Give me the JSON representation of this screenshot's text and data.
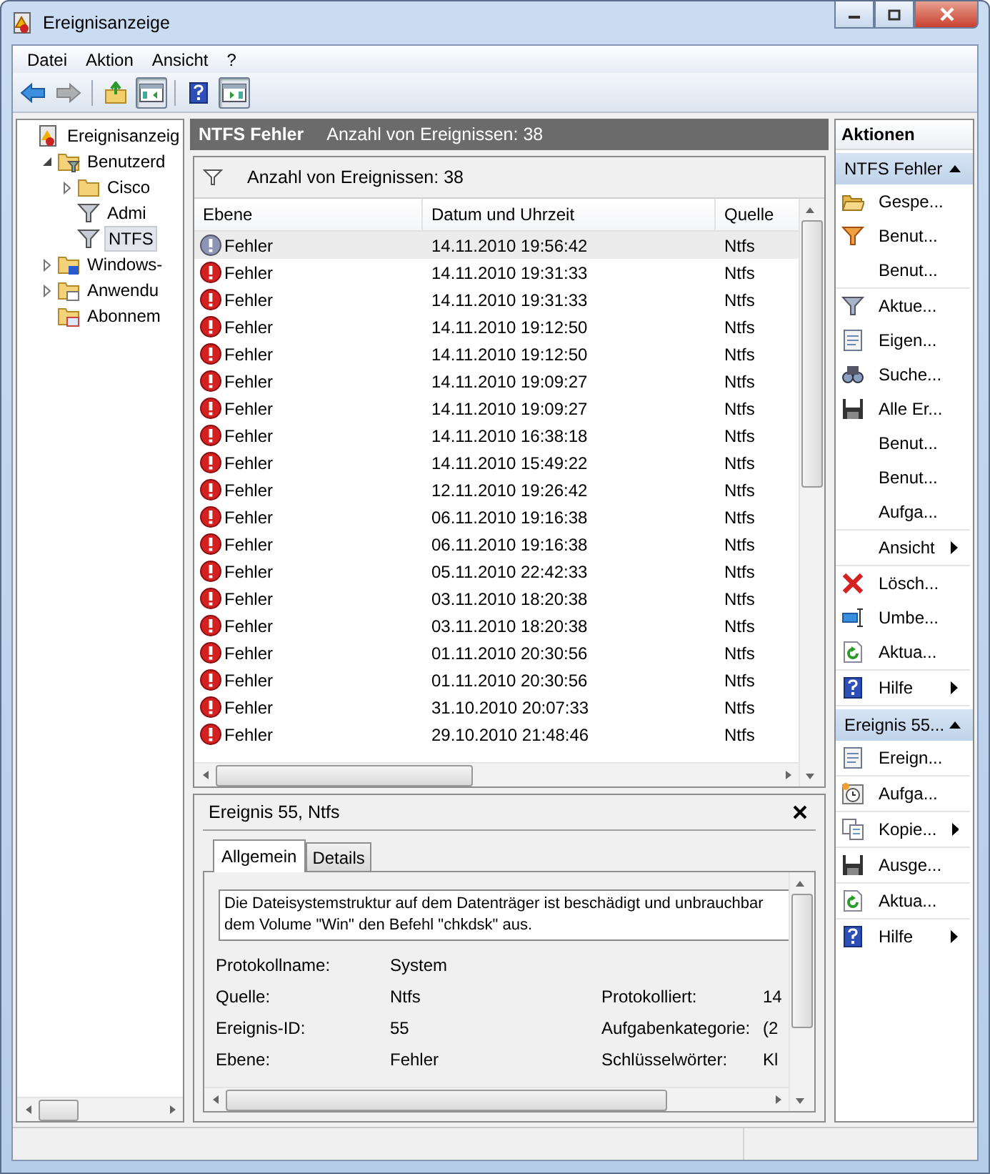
{
  "window": {
    "title": "Ereignisanzeige"
  },
  "menu": [
    "Datei",
    "Aktion",
    "Ansicht",
    "?"
  ],
  "toolbar": [
    {
      "kind": "back",
      "disabled": false,
      "pressed": false
    },
    {
      "kind": "forward",
      "disabled": true,
      "pressed": false
    },
    {
      "kind": "up",
      "disabled": false,
      "pressed": false
    },
    {
      "kind": "tree-toggle",
      "disabled": false,
      "pressed": true
    },
    {
      "kind": "help",
      "disabled": false,
      "pressed": false
    },
    {
      "kind": "pane-toggle",
      "disabled": false,
      "pressed": true
    }
  ],
  "tree": [
    {
      "label": "Ereignisanzeig",
      "kind": "viewer",
      "selected": false,
      "children": [
        {
          "label": "Benutzerd",
          "kind": "filter-folder",
          "expanded": true,
          "selected": false,
          "children": [
            {
              "label": "Cisco",
              "kind": "folder",
              "expanded": false,
              "selected": false
            },
            {
              "label": "Admi",
              "kind": "filter",
              "selected": false
            },
            {
              "label": "NTFS",
              "kind": "filter",
              "selected": true
            }
          ]
        },
        {
          "label": "Windows-",
          "kind": "log-folder",
          "expanded": false,
          "selected": false
        },
        {
          "label": "Anwendu",
          "kind": "app-folder",
          "expanded": false,
          "selected": false
        },
        {
          "label": "Abonnem",
          "kind": "sub-folder",
          "selected": false
        }
      ]
    }
  ],
  "header": {
    "title": "NTFS Fehler",
    "count": "Anzahl von Ereignissen: 38"
  },
  "filter_bar": "Anzahl von Ereignissen: 38",
  "columns": [
    "Ebene",
    "Datum und Uhrzeit",
    "Quelle"
  ],
  "events": [
    {
      "ebene": "Fehler",
      "date": "14.11.2010 19:56:42",
      "source": "Ntfs",
      "selected": true
    },
    {
      "ebene": "Fehler",
      "date": "14.11.2010 19:31:33",
      "source": "Ntfs",
      "selected": false
    },
    {
      "ebene": "Fehler",
      "date": "14.11.2010 19:31:33",
      "source": "Ntfs",
      "selected": false
    },
    {
      "ebene": "Fehler",
      "date": "14.11.2010 19:12:50",
      "source": "Ntfs",
      "selected": false
    },
    {
      "ebene": "Fehler",
      "date": "14.11.2010 19:12:50",
      "source": "Ntfs",
      "selected": false
    },
    {
      "ebene": "Fehler",
      "date": "14.11.2010 19:09:27",
      "source": "Ntfs",
      "selected": false
    },
    {
      "ebene": "Fehler",
      "date": "14.11.2010 19:09:27",
      "source": "Ntfs",
      "selected": false
    },
    {
      "ebene": "Fehler",
      "date": "14.11.2010 16:38:18",
      "source": "Ntfs",
      "selected": false
    },
    {
      "ebene": "Fehler",
      "date": "14.11.2010 15:49:22",
      "source": "Ntfs",
      "selected": false
    },
    {
      "ebene": "Fehler",
      "date": "12.11.2010 19:26:42",
      "source": "Ntfs",
      "selected": false
    },
    {
      "ebene": "Fehler",
      "date": "06.11.2010 19:16:38",
      "source": "Ntfs",
      "selected": false
    },
    {
      "ebene": "Fehler",
      "date": "06.11.2010 19:16:38",
      "source": "Ntfs",
      "selected": false
    },
    {
      "ebene": "Fehler",
      "date": "05.11.2010 22:42:33",
      "source": "Ntfs",
      "selected": false
    },
    {
      "ebene": "Fehler",
      "date": "03.11.2010 18:20:38",
      "source": "Ntfs",
      "selected": false
    },
    {
      "ebene": "Fehler",
      "date": "03.11.2010 18:20:38",
      "source": "Ntfs",
      "selected": false
    },
    {
      "ebene": "Fehler",
      "date": "01.11.2010 20:30:56",
      "source": "Ntfs",
      "selected": false
    },
    {
      "ebene": "Fehler",
      "date": "01.11.2010 20:30:56",
      "source": "Ntfs",
      "selected": false
    },
    {
      "ebene": "Fehler",
      "date": "31.10.2010 20:07:33",
      "source": "Ntfs",
      "selected": false
    },
    {
      "ebene": "Fehler",
      "date": "29.10.2010 21:48:46",
      "source": "Ntfs",
      "selected": false
    }
  ],
  "details": {
    "title": "Ereignis 55, Ntfs",
    "tabs": [
      {
        "label": "Allgemein",
        "selected": true
      },
      {
        "label": "Details",
        "selected": false
      }
    ],
    "message": [
      "Die Dateisystemstruktur auf dem Datenträger ist beschädigt und unbrauchbar",
      "dem Volume \"Win\" den Befehl \"chkdsk\" aus."
    ],
    "fields": [
      {
        "label": "Protokollname:",
        "value": "System"
      },
      {
        "label": "Quelle:",
        "value": "Ntfs",
        "label2": "Protokolliert:",
        "value2": "14"
      },
      {
        "label": "Ereignis-ID:",
        "value": "55",
        "label2": "Aufgabenkategorie:",
        "value2": "(2"
      },
      {
        "label": "Ebene:",
        "value": "Fehler",
        "label2": "Schlüsselwörter:",
        "value2": "Kl"
      }
    ]
  },
  "actions": {
    "title": "Aktionen",
    "sections": [
      {
        "title": "NTFS Fehler",
        "groups": [
          [
            {
              "label": "Gespe...",
              "kind": "open",
              "submenu": false
            },
            {
              "label": "Benut...",
              "kind": "filter-new",
              "submenu": false
            },
            {
              "label": "Benut...",
              "kind": "none",
              "submenu": false
            }
          ],
          [
            {
              "label": "Aktue...",
              "kind": "filter",
              "submenu": false
            },
            {
              "label": "Eigen...",
              "kind": "properties",
              "submenu": false
            },
            {
              "label": "Suche...",
              "kind": "find",
              "submenu": false
            },
            {
              "label": "Alle Er...",
              "kind": "save",
              "submenu": false
            },
            {
              "label": "Benut...",
              "kind": "none",
              "submenu": false
            },
            {
              "label": "Benut...",
              "kind": "none",
              "submenu": false
            },
            {
              "label": "Aufga...",
              "kind": "none",
              "submenu": false
            }
          ],
          [
            {
              "label": "Ansicht",
              "kind": "none",
              "submenu": true
            }
          ],
          [
            {
              "label": "Lösch...",
              "kind": "delete",
              "submenu": false
            },
            {
              "label": "Umbe...",
              "kind": "rename",
              "submenu": false
            },
            {
              "label": "Aktua...",
              "kind": "refresh",
              "submenu": false
            }
          ],
          [
            {
              "label": "Hilfe",
              "kind": "help",
              "submenu": true
            }
          ]
        ]
      },
      {
        "title": "Ereignis 55...",
        "groups": [
          [
            {
              "label": "Ereign...",
              "kind": "properties",
              "submenu": false
            }
          ],
          [
            {
              "label": "Aufga...",
              "kind": "task",
              "submenu": false
            }
          ],
          [
            {
              "label": "Kopie...",
              "kind": "copy",
              "submenu": true
            }
          ],
          [
            {
              "label": "Ausge...",
              "kind": "save",
              "submenu": false
            }
          ],
          [
            {
              "label": "Aktua...",
              "kind": "refresh",
              "submenu": false
            }
          ],
          [
            {
              "label": "Hilfe",
              "kind": "help",
              "submenu": true
            }
          ]
        ]
      }
    ]
  }
}
